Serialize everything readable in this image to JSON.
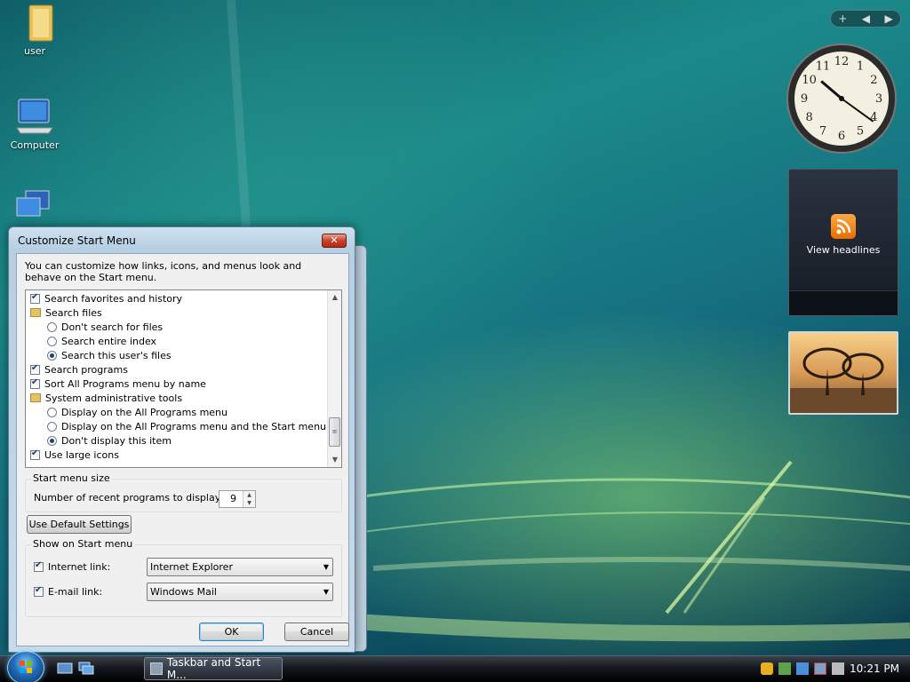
{
  "desktop": {
    "icons": [
      {
        "label": "user"
      },
      {
        "label": "Computer"
      },
      {
        "label": ""
      }
    ]
  },
  "sidebar": {
    "controls": [
      "+",
      "◀",
      "▶"
    ],
    "clock": {
      "numbers": [
        "12",
        "1",
        "2",
        "3",
        "4",
        "5",
        "6",
        "7",
        "8",
        "9",
        "10",
        "11"
      ],
      "hour": 10,
      "minute": 21
    },
    "feed": {
      "label": "View headlines"
    }
  },
  "dialog": {
    "title": "Customize Start Menu",
    "close_label": "✕",
    "description": "You can customize how links, icons, and menus look and behave on the Start menu.",
    "list": [
      {
        "kind": "checkbox",
        "checked": true,
        "indent": 0,
        "label": "Search favorites and history"
      },
      {
        "kind": "folder",
        "indent": 0,
        "label": "Search files"
      },
      {
        "kind": "radio",
        "selected": false,
        "indent": 1,
        "label": "Don't search for files"
      },
      {
        "kind": "radio",
        "selected": false,
        "indent": 1,
        "label": "Search entire index"
      },
      {
        "kind": "radio",
        "selected": true,
        "indent": 1,
        "label": "Search this user's files"
      },
      {
        "kind": "checkbox",
        "checked": true,
        "indent": 0,
        "label": "Search programs"
      },
      {
        "kind": "checkbox",
        "checked": true,
        "indent": 0,
        "label": "Sort All Programs menu by name"
      },
      {
        "kind": "folder",
        "indent": 0,
        "label": "System administrative tools"
      },
      {
        "kind": "radio",
        "selected": false,
        "indent": 1,
        "label": "Display on the All Programs menu"
      },
      {
        "kind": "radio",
        "selected": false,
        "indent": 1,
        "label": "Display on the All Programs menu and the Start menu"
      },
      {
        "kind": "radio",
        "selected": true,
        "indent": 1,
        "label": "Don't display this item"
      },
      {
        "kind": "checkbox",
        "checked": true,
        "indent": 0,
        "label": "Use large icons"
      }
    ],
    "size_group": {
      "title": "Start menu size",
      "recent_label": "Number of recent programs to display:",
      "recent_value": "9"
    },
    "default_button": "Use Default Settings",
    "show_group": {
      "title": "Show on Start menu",
      "internet_label": "Internet link:",
      "internet_value": "Internet Explorer",
      "email_label": "E-mail link:",
      "email_value": "Windows Mail"
    },
    "ok_label": "OK",
    "cancel_label": "Cancel"
  },
  "taskbar": {
    "task_label": "Taskbar and Start M...",
    "clock": "10:21 PM"
  }
}
